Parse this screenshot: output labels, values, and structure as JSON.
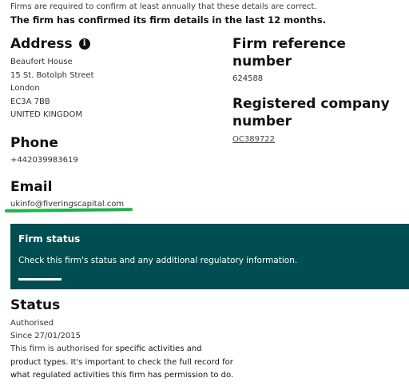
{
  "notice": {
    "line1": "Firms are required to confirm at least annually that these details are correct.",
    "line2": "The firm has confirmed its firm details in the last 12 months."
  },
  "address": {
    "heading": "Address",
    "info_icon": "i",
    "lines": [
      "Beaufort House",
      "15 St. Botolph Street",
      "London",
      "EC3A 7BB",
      "UNITED KINGDOM"
    ]
  },
  "firm_reference": {
    "heading": "Firm reference number",
    "value": "624588"
  },
  "registered_company": {
    "heading_line1": "Registered company",
    "heading_line2": "number",
    "value": "OC389722"
  },
  "phone": {
    "heading": "Phone",
    "value": "+442039983619"
  },
  "email": {
    "heading": "Email",
    "value": "ukinfo@fiveringscapital.com",
    "annotation_color": "#1fb34b"
  },
  "firm_status_banner": {
    "title": "Firm status",
    "text": "Check this firm's status and any additional regulatory information.",
    "background": "#004e52"
  },
  "status": {
    "heading": "Status",
    "value": "Authorised",
    "since": "Since 27/01/2015",
    "desc_part1": "This firm is authorised for ",
    "desc_part2": "specific activities and product types. It's important to check the full record for what regulated activities this firm has permission to do."
  }
}
